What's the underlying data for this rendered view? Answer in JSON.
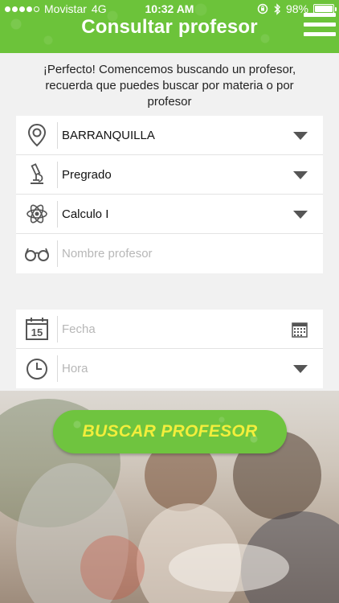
{
  "status_bar": {
    "carrier": "Movistar",
    "network": "4G",
    "time": "10:32 AM",
    "battery": "98%",
    "battery_level": 0.98
  },
  "header": {
    "title": "Consultar profesor",
    "menu_icon": "hamburger-menu-icon",
    "color": "#6cc33a"
  },
  "intro_text": "¡Perfecto! Comencemos buscando un profesor, recuerda que puedes buscar por materia o por profesor",
  "form": {
    "city": {
      "icon": "location-pin-icon",
      "value": "BARRANQUILLA"
    },
    "level": {
      "icon": "microscope-icon",
      "value": "Pregrado"
    },
    "subject": {
      "icon": "atom-icon",
      "value": "Calculo I"
    },
    "teacher": {
      "icon": "glasses-icon",
      "placeholder": "Nombre profesor"
    },
    "date": {
      "icon": "calendar-icon",
      "calendar_day": "15",
      "placeholder": "Fecha"
    },
    "time": {
      "icon": "clock-icon",
      "placeholder": "Hora"
    }
  },
  "search_button": {
    "label": "BUSCAR PROFESOR",
    "bg_color": "#6fc43f",
    "text_color": "#f2ee3c"
  }
}
